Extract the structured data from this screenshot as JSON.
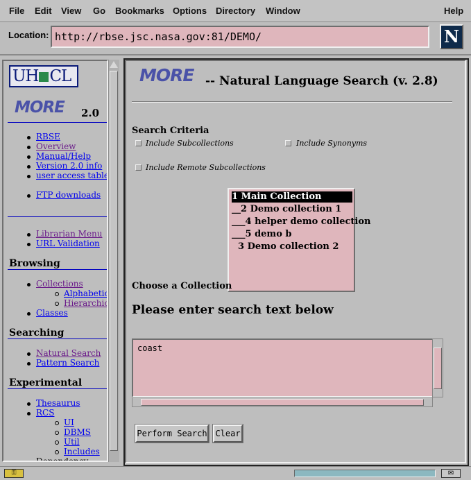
{
  "menu": [
    "File",
    "Edit",
    "View",
    "Go",
    "Bookmarks",
    "Options",
    "Directory",
    "Window",
    "Help"
  ],
  "location": {
    "label": "Location:",
    "url": "http://rbse.jsc.nasa.gov:81/DEMO/"
  },
  "browser_logo": "N",
  "sidebar": {
    "uhcl_logo": "UH CL",
    "more_logo": "MORE",
    "version": "2.0",
    "top_links": [
      "RBSE",
      "Overview",
      "Manual/Help",
      "Version 2.0 info",
      "user access table"
    ],
    "ftp_link": "FTP downloads",
    "admin_links": [
      "Librarian Menu",
      "URL Validation"
    ],
    "browsing": {
      "heading": "Browsing",
      "collections": "Collections",
      "sub": [
        "Alphabetic",
        "Hierarchic"
      ],
      "classes": "Classes"
    },
    "searching": {
      "heading": "Searching",
      "links": [
        "Natural Search",
        "Pattern Search"
      ]
    },
    "experimental": {
      "heading": "Experimental",
      "thesaurus": "Thesaurus",
      "rcs": "RCS",
      "rcs_sub": [
        "UI",
        "DBMS",
        "Util",
        "Includes"
      ],
      "dependency": "Dependency"
    }
  },
  "main": {
    "logo": "MORE",
    "title": "-- Natural Language Search (v. 2.8)",
    "criteria_heading": "Search Criteria",
    "options": [
      "Include Subcollections",
      "Include Synonyms",
      "Include Remote Subcollections"
    ],
    "collections": [
      "1 Main Collection",
      "__2 Demo collection 1",
      "___4 helper demo collection",
      "___5 demo b",
      "  3 Demo collection 2"
    ],
    "selected_collection": "1 Main Collection",
    "choose_label": "Choose a Collection",
    "enter_label": "Please enter search text below",
    "search_text": "coast",
    "perform_button": "Perform Search",
    "clear_button": "Clear"
  }
}
